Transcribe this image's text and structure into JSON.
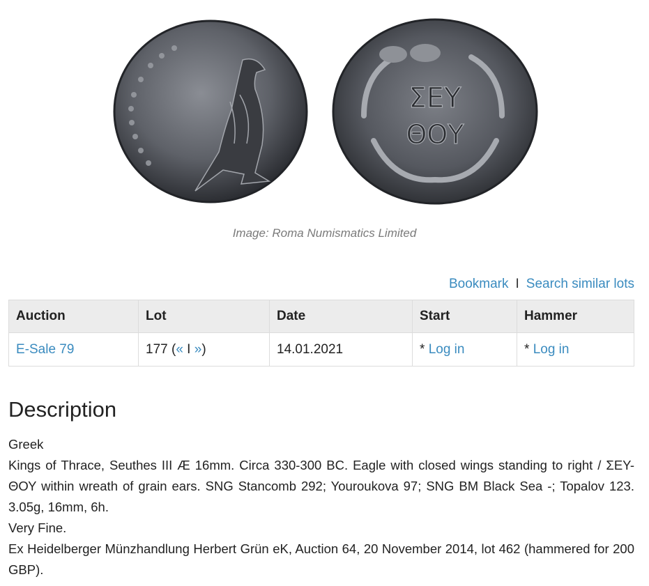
{
  "image": {
    "alt": "Kings of Thrace, Seuthes III bronze coin, obverse and reverse",
    "obverse_icon": "eagle-icon",
    "reverse_legend_top": "ΣΕΥ",
    "reverse_legend_bottom": "ΘΟΥ"
  },
  "caption": "Image: Roma Numismatics Limited",
  "actions": {
    "bookmark": "Bookmark",
    "separator": "I",
    "search_similar": "Search similar lots"
  },
  "table": {
    "headers": {
      "auction": "Auction",
      "lot": "Lot",
      "date": "Date",
      "start": "Start",
      "hammer": "Hammer"
    },
    "row": {
      "auction": "E-Sale 79",
      "lot_number": "177 (",
      "prev": "«",
      "lot_sep": " I ",
      "next": "»",
      "lot_close": ")",
      "date": "14.01.2021",
      "start_prefix": "* ",
      "start_link": "Log in",
      "hammer_prefix": "* ",
      "hammer_link": "Log in"
    }
  },
  "description": {
    "title": "Description",
    "category": "Greek",
    "text": "Kings of Thrace, Seuthes III Æ 16mm. Circa 330-300 BC. Eagle with closed wings standing to right / ΣΕΥ-ΘΟΥ within wreath of grain ears. SNG Stancomb 292; Youroukova 97; SNG BM Black Sea -; Topalov 123. 3.05g, 16mm, 6h.",
    "grade": "Very Fine.",
    "provenance": "Ex Heidelberger Münzhandlung Herbert Grün eK, Auction 64, 20 November 2014, lot 462 (hammered for 200 GBP)."
  },
  "colors": {
    "link": "#3a8bbf",
    "header_bg": "#ececec",
    "coin_metal": "#4d4f55"
  }
}
